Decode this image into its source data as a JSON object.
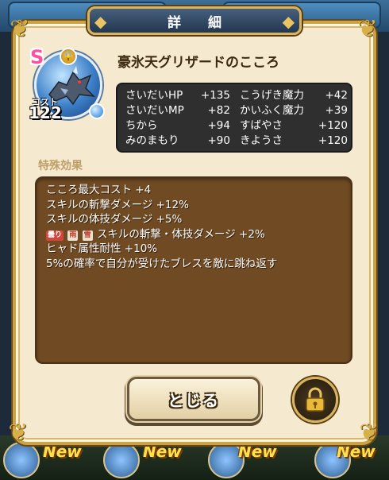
{
  "dialog": {
    "title": "詳 細",
    "heart_name": "豪氷天グリザードのこころ",
    "rank": "S",
    "cost_label": "コスト",
    "cost_value": "122"
  },
  "stats": [
    {
      "name": "さいだいHP",
      "value": "+135"
    },
    {
      "name": "こうげき魔力",
      "value": "+42"
    },
    {
      "name": "さいだいMP",
      "value": "+82"
    },
    {
      "name": "かいふく魔力",
      "value": "+39"
    },
    {
      "name": "ちから",
      "value": "+94"
    },
    {
      "name": "すばやさ",
      "value": "+120"
    },
    {
      "name": "みのまもり",
      "value": "+90"
    },
    {
      "name": "きようさ",
      "value": "+120"
    }
  ],
  "effects": {
    "section_title": "特殊効果",
    "lines": [
      "こころ最大コスト +4",
      "スキルの斬撃ダメージ +12%",
      "スキルの体技ダメージ +5%",
      "スキルの斬撃・体技ダメージ +2%",
      "ヒャド属性耐性 +10%",
      "5%の確率で自分が受けたブレスを敵に跳ね返す"
    ],
    "condition_tags": [
      "曇り",
      "雨",
      "雪"
    ]
  },
  "buttons": {
    "close_label": "とじる",
    "lock_icon": "lock-icon"
  },
  "background": {
    "new_badge": "New"
  },
  "colors": {
    "panel_bg": "#f5e9cf",
    "panel_border": "#caa24a",
    "stats_bg": "#2f2f2f",
    "effects_bg": "#6f4a23",
    "title_plate": "#22364f",
    "rank_color": "#ff4fa3"
  }
}
